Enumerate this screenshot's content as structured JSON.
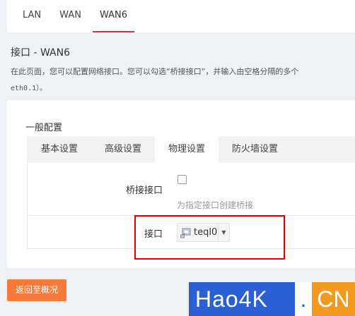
{
  "top_tabs": [
    {
      "label": "LAN",
      "active": false
    },
    {
      "label": "WAN",
      "active": false
    },
    {
      "label": "WAN6",
      "active": true
    }
  ],
  "page": {
    "title": "接口 - WAN6",
    "description": "在此页面，您可以配置网络接口。您可以勾选“桥接接口”，并输入由空格分隔的多个",
    "description_2": "eth0.1）。"
  },
  "section": {
    "title": "一般配置",
    "tabs": [
      {
        "label": "基本设置",
        "active": false
      },
      {
        "label": "高级设置",
        "active": false
      },
      {
        "label": "物理设置",
        "active": true
      },
      {
        "label": "防火墙设置",
        "active": false
      }
    ]
  },
  "form": {
    "bridge_label": "桥接接口",
    "bridge_checked": false,
    "bridge_hint": "为指定接口创建桥接",
    "interface_label": "接口",
    "interface_value": "teql0"
  },
  "footer": {
    "back_button": "返回至概况"
  },
  "watermark": {
    "part1": "Hao4K",
    "dot": ".",
    "part2": "CN"
  },
  "colors": {
    "accent_red": "#d9313a",
    "button_orange": "#f47b3a",
    "highlight_red": "#e00000"
  }
}
